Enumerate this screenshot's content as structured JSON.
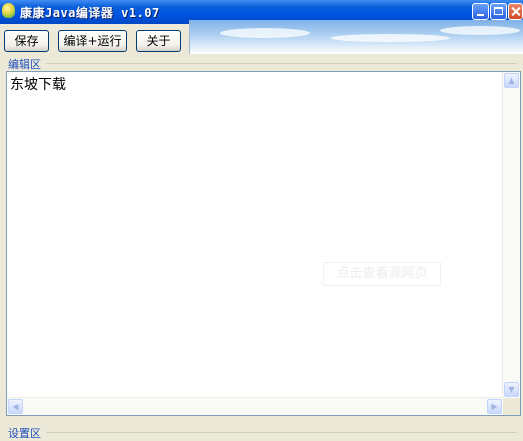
{
  "window": {
    "title": "康康Java编译器 v1.07"
  },
  "toolbar": {
    "save_label": "保存",
    "compile_run_label": "编译+运行",
    "about_label": "关于"
  },
  "editor": {
    "group_label": "编辑区",
    "content": "东坡下载",
    "watermark": "点击查看源网页"
  },
  "settings": {
    "group_label": "设置区"
  },
  "colors": {
    "titlebar": "#0054e3",
    "window_bg": "#ece9d8",
    "group_label": "#1f4fbd"
  }
}
